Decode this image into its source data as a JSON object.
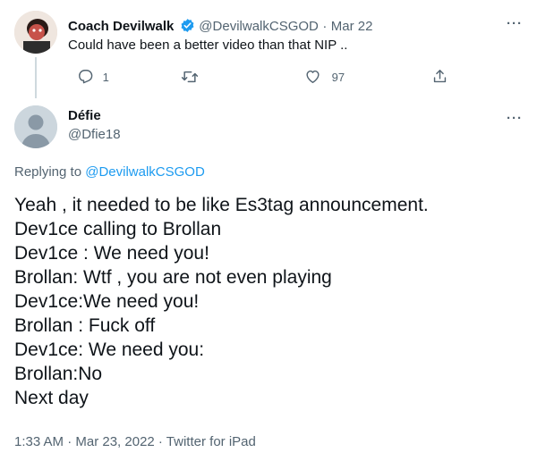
{
  "parent_tweet": {
    "display_name": "Coach Devilwalk",
    "handle": "@DevilwalkCSGOD",
    "separator": "·",
    "date": "Mar 22",
    "text": "Could have been a better video than that NIP ..",
    "reply_count": "1",
    "like_count": "97",
    "verified_color": "#1d9bf0"
  },
  "reply_tweet": {
    "display_name": "Défie",
    "handle": "@Dfie18",
    "replying_to_prefix": "Replying to",
    "replying_to_handle": "@DevilwalkCSGOD",
    "lines": [
      "Yeah , it needed to be like Es3tag announcement.",
      "Dev1ce calling to Brollan",
      "Dev1ce : We need you!",
      "Brollan: Wtf , you are not even playing",
      "Dev1ce:We need you!",
      "Brollan : Fuck off",
      "Dev1ce: We need you:",
      "Brollan:No",
      "Next day"
    ],
    "timestamp": "1:33 AM · Mar 23, 2022 · Twitter for iPad"
  },
  "more_label": "···"
}
